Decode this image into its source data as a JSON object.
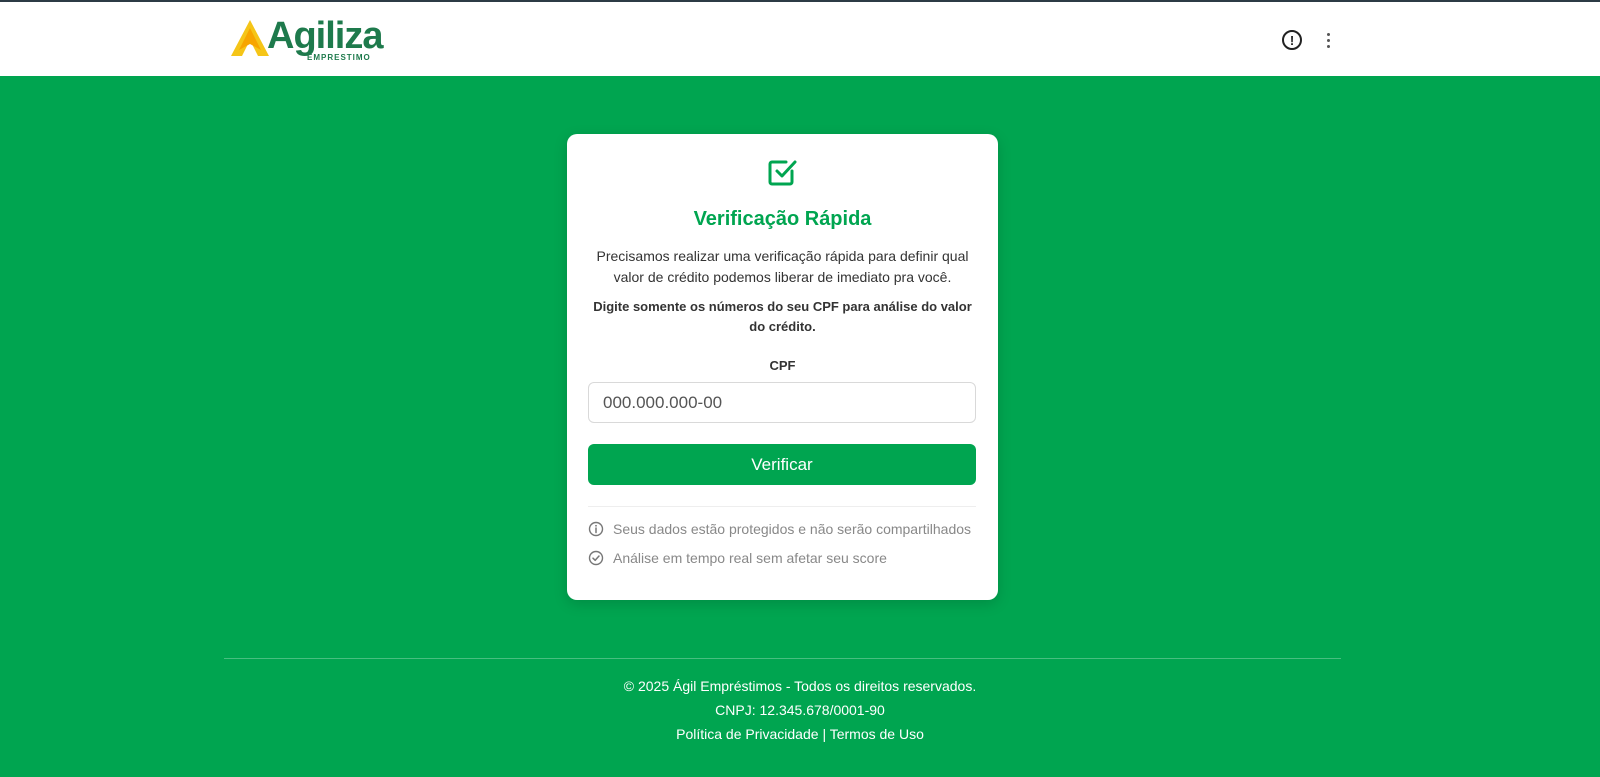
{
  "header": {
    "logo_text": "Agiliza",
    "logo_subtext": "EMPRESTIMO",
    "icons": [
      "alert-circle-icon",
      "more-vertical-icon"
    ]
  },
  "card": {
    "icon": "checkbox-checked-icon",
    "title": "Verificação Rápida",
    "description": "Precisamos realizar uma verificação rápida para definir qual valor de crédito podemos liberar de imediato pra você.",
    "instruction": "Digite somente os números do seu CPF para análise do valor do crédito.",
    "cpf_label": "CPF",
    "cpf_placeholder": "000.000.000-00",
    "cpf_value": "",
    "button_label": "Verificar",
    "features": [
      {
        "icon": "info-icon",
        "text": "Seus dados estão protegidos e não serão compartilhados"
      },
      {
        "icon": "check-circle-icon",
        "text": "Análise em tempo real sem afetar seu score"
      }
    ]
  },
  "footer": {
    "copyright": "© 2025 Ágil Empréstimos - Todos os direitos reservados.",
    "cnpj": "CNPJ: 12.345.678/0001-90",
    "privacy_label": "Política de Privacidade",
    "separator": "|",
    "terms_label": "Termos de Uso"
  },
  "colors": {
    "brand_green": "#00a550",
    "logo_green": "#1e7a4c",
    "logo_yellow": "#f5c518",
    "header_bg": "#ffffff",
    "card_bg": "#ffffff"
  }
}
